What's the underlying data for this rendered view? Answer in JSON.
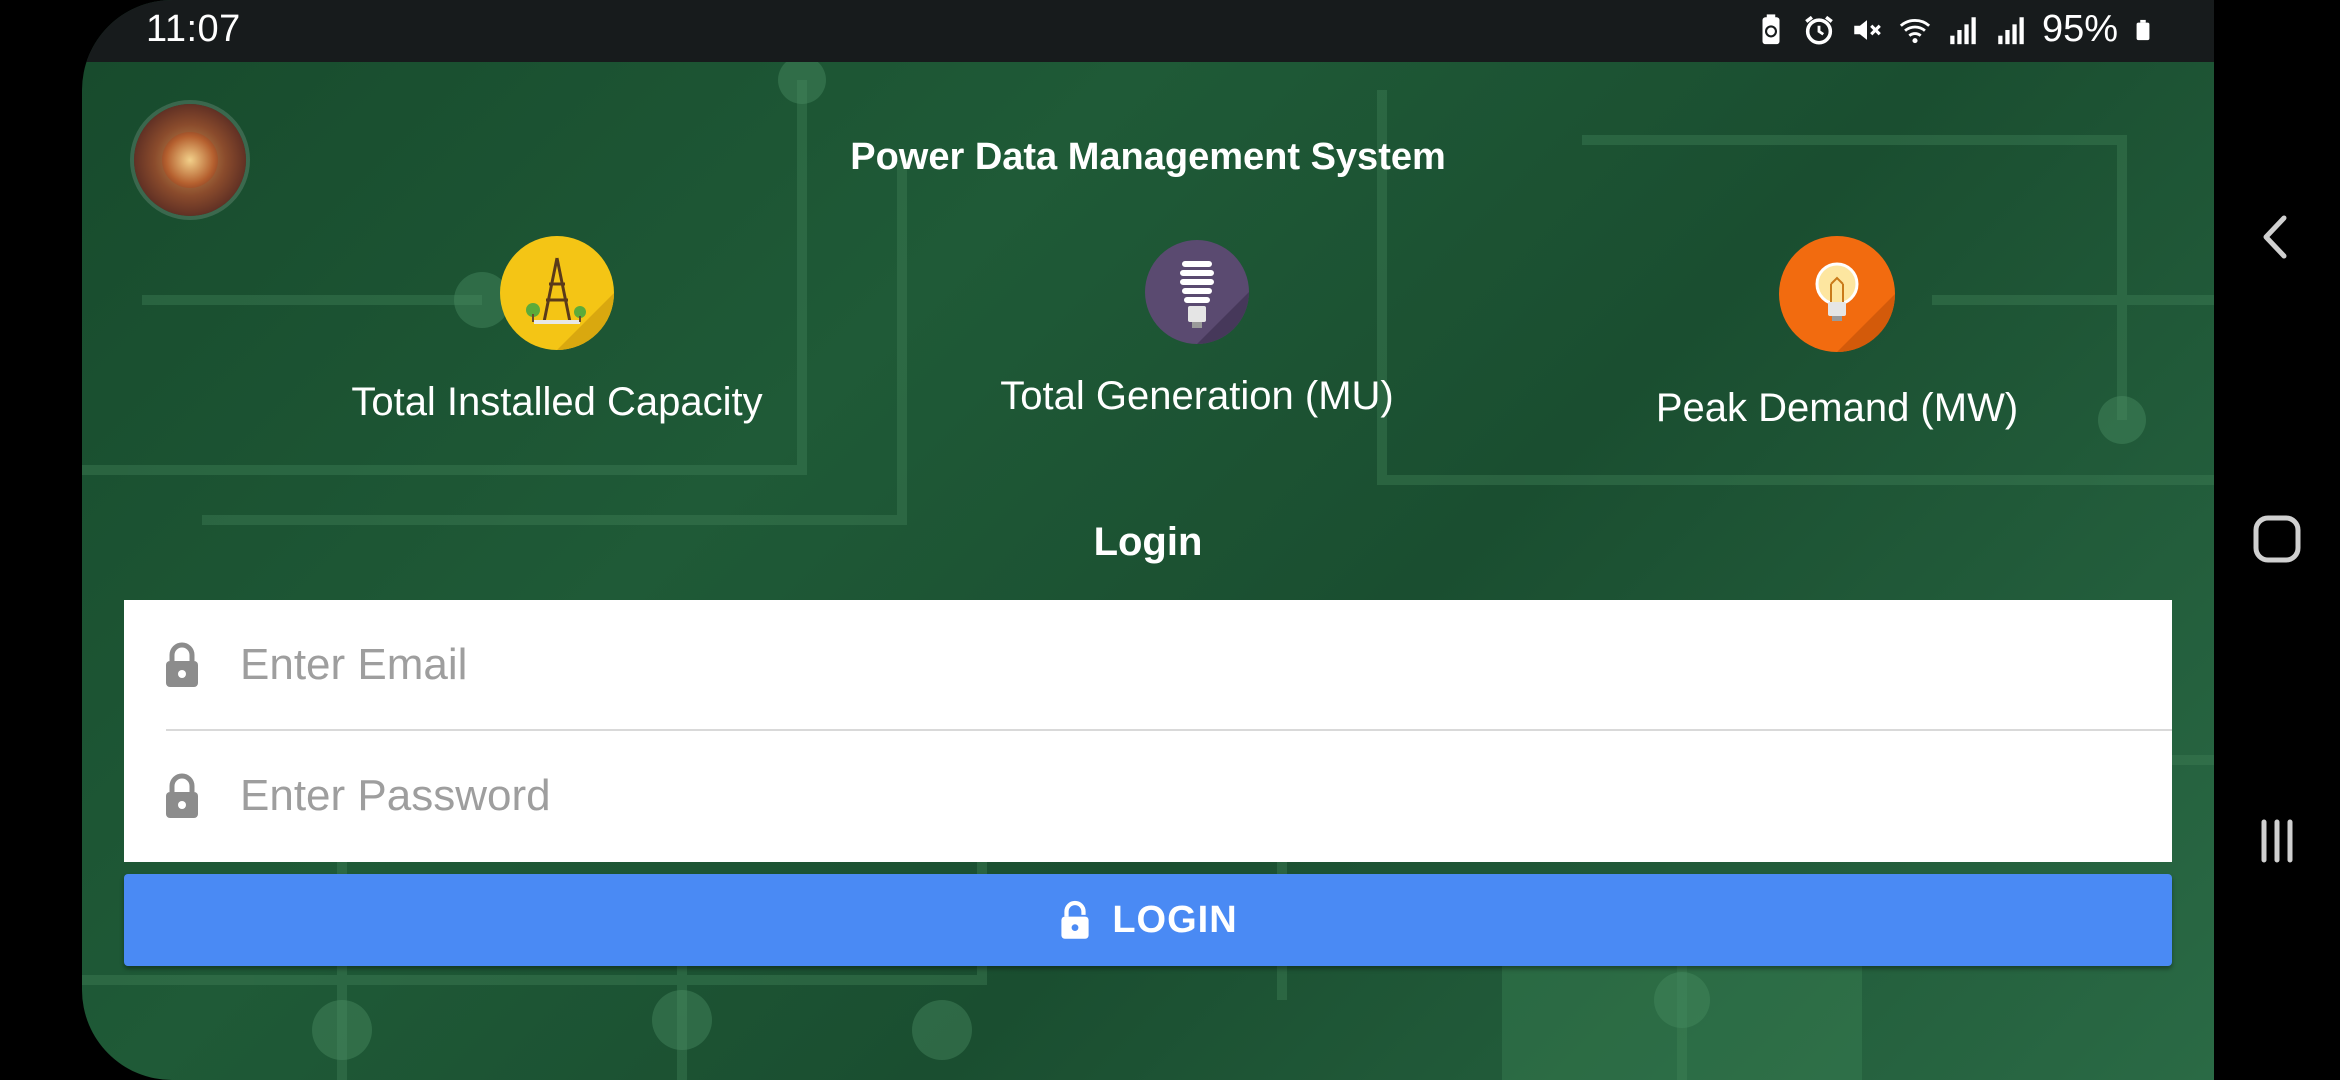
{
  "status_bar": {
    "time": "11:07",
    "battery_percent": "95%",
    "icons": [
      "battery-saver-icon",
      "alarm-icon",
      "mute-icon",
      "wifi-icon",
      "signal-icon",
      "signal-icon",
      "battery-icon"
    ]
  },
  "app": {
    "logo": "emblem-logo",
    "title": "Power Data Management System"
  },
  "stats": [
    {
      "label": "Total Installed Capacity",
      "icon": "transmission-tower-icon",
      "color": "#f4c515"
    },
    {
      "label": "Total Generation (MU)",
      "icon": "cfl-bulb-icon",
      "color": "#5a4a70"
    },
    {
      "label": "Peak Demand (MW)",
      "icon": "lightbulb-icon",
      "color": "#f26b0f"
    }
  ],
  "login": {
    "title": "Login",
    "email_placeholder": "Enter Email",
    "password_placeholder": "Enter Password",
    "button_label": "LOGIN",
    "button_color": "#4a8af4"
  },
  "navigation": {
    "buttons": [
      "back-icon",
      "home-icon",
      "recents-icon"
    ]
  }
}
